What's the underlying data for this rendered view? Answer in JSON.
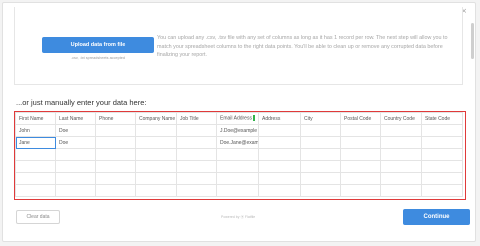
{
  "close_glyph": "×",
  "upload": {
    "button_label": "Upload data from file",
    "sub_label": ".csv, .txt spreadsheets accepted",
    "description": "You can upload any .csv, .tsv file with any set of columns as long as it has 1 record per row. The next step will allow you to match your spreadsheet columns to the right data points. You'll be able to clean up or remove any corrupted data before finalizing your report."
  },
  "manual": {
    "heading": "...or just manually enter your data here:"
  },
  "grid": {
    "columns": [
      "First Name",
      "Last Name",
      "Phone",
      "Company Name",
      "Job Title",
      "Email Address",
      "Address",
      "City",
      "Postal Code",
      "Country Code",
      "State Code"
    ],
    "rows": [
      [
        "John",
        "Doe",
        "",
        "",
        "",
        "J.Doe@example",
        "",
        "",
        "",
        "",
        ""
      ],
      [
        "Jane",
        "Doe",
        "",
        "",
        "",
        "Doe.Jane@exam",
        "",
        "",
        "",
        "",
        ""
      ],
      [
        "",
        "",
        "",
        "",
        "",
        "",
        "",
        "",
        "",
        "",
        ""
      ],
      [
        "",
        "",
        "",
        "",
        "",
        "",
        "",
        "",
        "",
        "",
        ""
      ],
      [
        "",
        "",
        "",
        "",
        "",
        "",
        "",
        "",
        "",
        "",
        ""
      ],
      [
        "",
        "",
        "",
        "",
        "",
        "",
        "",
        "",
        "",
        "",
        ""
      ]
    ]
  },
  "footer": {
    "clear_label": "Clear data",
    "powered_by": "Powered by ⦿ Flatfile",
    "continue_label": "Continue"
  },
  "colors": {
    "accent": "#3e8bdf",
    "highlight_border": "#e03a3a",
    "required_flag": "#32b34a"
  }
}
